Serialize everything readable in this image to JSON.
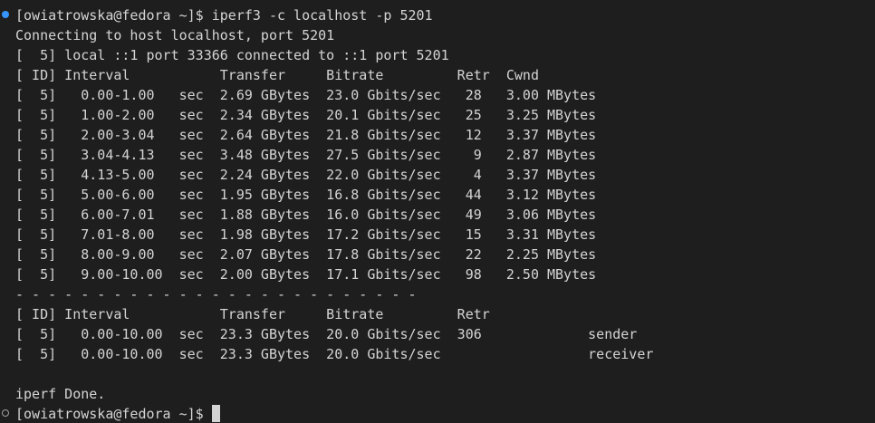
{
  "terminal": {
    "lines": [
      "[owiatrowska@fedora ~]$ iperf3 -c localhost -p 5201",
      "Connecting to host localhost, port 5201",
      "[  5] local ::1 port 33366 connected to ::1 port 5201",
      "[ ID] Interval           Transfer     Bitrate         Retr  Cwnd",
      "[  5]   0.00-1.00   sec  2.69 GBytes  23.0 Gbits/sec   28   3.00 MBytes",
      "[  5]   1.00-2.00   sec  2.34 GBytes  20.1 Gbits/sec   25   3.25 MBytes",
      "[  5]   2.00-3.04   sec  2.64 GBytes  21.8 Gbits/sec   12   3.37 MBytes",
      "[  5]   3.04-4.13   sec  3.48 GBytes  27.5 Gbits/sec    9   2.87 MBytes",
      "[  5]   4.13-5.00   sec  2.24 GBytes  22.0 Gbits/sec    4   3.37 MBytes",
      "[  5]   5.00-6.00   sec  1.95 GBytes  16.8 Gbits/sec   44   3.12 MBytes",
      "[  5]   6.00-7.01   sec  1.88 GBytes  16.0 Gbits/sec   49   3.06 MBytes",
      "[  5]   7.01-8.00   sec  1.98 GBytes  17.2 Gbits/sec   15   3.31 MBytes",
      "[  5]   8.00-9.00   sec  2.07 GBytes  17.8 Gbits/sec   22   2.25 MBytes",
      "[  5]   9.00-10.00  sec  2.00 GBytes  17.1 Gbits/sec   98   2.50 MBytes",
      "- - - - - - - - - - - - - - - - - - - - - - - - -",
      "[ ID] Interval           Transfer     Bitrate         Retr",
      "[  5]   0.00-10.00  sec  23.3 GBytes  20.0 Gbits/sec  306             sender",
      "[  5]   0.00-10.00  sec  23.3 GBytes  20.0 Gbits/sec                  receiver",
      "",
      "iperf Done."
    ],
    "prompt": "[owiatrowska@fedora ~]$"
  },
  "colors": {
    "background": "#1e1e1e",
    "foreground": "#d4d4d4",
    "decoration_success": "#3794ff"
  },
  "icons": {
    "command_success": "command-success-dot",
    "command_pending": "command-pending-circle",
    "cursor": "block-cursor"
  }
}
